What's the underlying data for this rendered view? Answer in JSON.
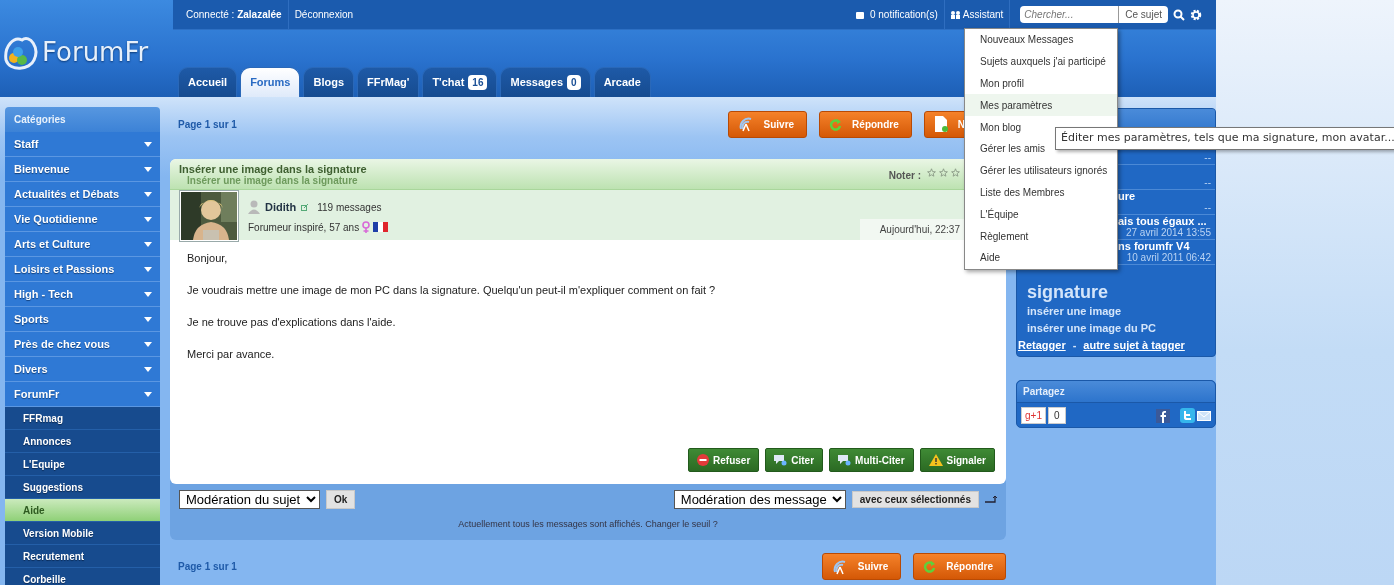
{
  "logo": "ForumFr",
  "top_bar": {
    "user": "Connecté : **Zalazalée**",
    "logout": "Déconnexion",
    "notifications": "0 notification(s)",
    "assistant": "Assistant",
    "search": {
      "placeholder": "Chercher...",
      "scope": "Ce sujet"
    }
  },
  "tabs": [
    {
      "label": "Accueil",
      "selected": false
    },
    {
      "label": "Forums",
      "selected": true
    },
    {
      "label": "Blogs",
      "selected": false
    },
    {
      "label": "FFrMag'",
      "selected": false
    },
    {
      "label": "T'chat",
      "selected": false,
      "badge": "16"
    },
    {
      "label": "Messages",
      "selected": false,
      "badge": "0"
    },
    {
      "label": "Arcade",
      "selected": false
    }
  ],
  "assistant_menu": [
    {
      "label": "Nouveaux Messages",
      "selected": false
    },
    {
      "label": "Sujets auxquels j'ai participé",
      "selected": false
    },
    {
      "label": "Mon profil",
      "selected": false
    },
    {
      "label": "Mes paramètres",
      "selected": true
    },
    {
      "label": "Mon blog",
      "selected": false
    },
    {
      "label": "Gérer les amis",
      "selected": false
    },
    {
      "label": "Gérer les utilisateurs ignorés",
      "selected": false
    },
    {
      "label": "Liste des Membres",
      "selected": false
    },
    {
      "label": "L'Équipe",
      "selected": false
    },
    {
      "label": "Règlement",
      "selected": false
    },
    {
      "label": "Aide",
      "selected": false
    }
  ],
  "tooltip": "Éditer mes paramètres, tels que ma signature, mon avatar...",
  "sidebar": {
    "title": "Catégories",
    "categories": [
      {
        "label": "Staff"
      },
      {
        "label": "Bienvenue"
      },
      {
        "label": "Actualités et Débats"
      },
      {
        "label": "Vie Quotidienne"
      },
      {
        "label": "Arts et Culture"
      },
      {
        "label": "Loisirs et Passions"
      },
      {
        "label": "High - Tech"
      },
      {
        "label": "Sports"
      },
      {
        "label": "Près de chez vous"
      },
      {
        "label": "Divers"
      },
      {
        "label": "ForumFr",
        "children": [
          {
            "label": "FFRmag",
            "selected": false
          },
          {
            "label": "Annonces",
            "selected": false
          },
          {
            "label": "L'Equipe",
            "selected": false
          },
          {
            "label": "Suggestions",
            "selected": false
          },
          {
            "label": "Aide",
            "selected": true
          },
          {
            "label": "Version Mobile",
            "selected": false
          },
          {
            "label": "Recrutement",
            "selected": false
          },
          {
            "label": "Corbeille",
            "selected": false
          }
        ]
      }
    ]
  },
  "topic": {
    "pager": "Page 1 sur 1",
    "actions": [
      {
        "label": "Suivre",
        "kind": "follow"
      },
      {
        "label": "Répondre",
        "kind": "reply"
      },
      {
        "label": "N",
        "kind": "new"
      }
    ],
    "title": "Insérer une image dans la signature",
    "subtitle": "Insérer une image dans la signature",
    "rating_label": "Noter :",
    "stars": 0,
    "post": {
      "author": "Didith",
      "post_count": "119 messages",
      "rank": "Forumeur inspiré, 57 ans",
      "date": "Aujourd'hui, 22:37",
      "paragraphs": [
        "Bonjour,",
        "Je voudrais mettre une image de mon PC dans la signature. Quelqu'un peut-il m'expliquer comment on fait ?",
        "Je ne trouve pas d'explications dans l'aide.",
        "Merci par avance."
      ],
      "buttons": [
        {
          "label": "Refuser",
          "kind": "refuse"
        },
        {
          "label": "Citer",
          "kind": "quote"
        },
        {
          "label": "Multi-Citer",
          "kind": "multiquote"
        },
        {
          "label": "Signaler",
          "kind": "report"
        }
      ]
    },
    "moderation": {
      "topic_select": "Modération du sujet",
      "topic_ok": "Ok",
      "message_select": "Modération des message",
      "message_apply": "avec ceux sélectionnés",
      "notice": "Actuellement tous les messages sont affichés. Changer le seuil ?"
    },
    "bottom_pager": "Page 1 sur 1",
    "bottom_actions": [
      {
        "label": "Suivre",
        "kind": "follow"
      },
      {
        "label": "Répondre",
        "kind": "reply"
      }
    ]
  },
  "right_panel": {
    "rows": [
      {
        "meta": "--"
      },
      {
        "meta": "--"
      },
      {
        "title": "ure",
        "meta": "--"
      },
      {
        "title": "ais tous égaux ...",
        "meta": "27 avril 2014 13:55"
      },
      {
        "title": "ns forumfr V4",
        "meta": "10 avril 2011 06:42"
      }
    ],
    "tags": {
      "headline": "signature",
      "items": [
        "insérer une image",
        "insérer une image du PC"
      ],
      "links": [
        "Retagger",
        "autre sujet à tagger"
      ],
      "separator": "-"
    }
  },
  "share": {
    "title": "Partagez",
    "gplus": "g+1",
    "count": "0"
  }
}
